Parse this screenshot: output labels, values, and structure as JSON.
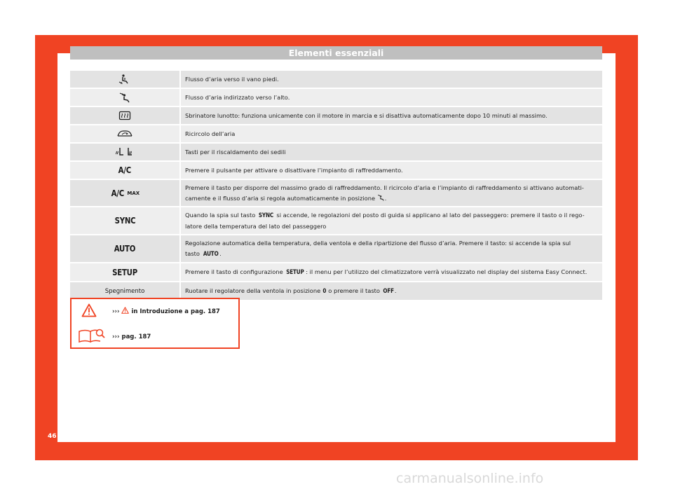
{
  "header": {
    "title": "Elementi essenziali"
  },
  "rows": [
    {
      "icon": "airflow-feet-icon",
      "desc": "Flusso d’aria verso il vano piedi."
    },
    {
      "icon": "airflow-up-icon",
      "desc": "Flusso d’aria indirizzato verso l’alto."
    },
    {
      "icon": "rear-defrost-icon",
      "desc": "Sbrinatore lunotto: funziona unicamente con il motore in marcia e si disattiva automaticamente dopo 10 minuti al massimo."
    },
    {
      "icon": "air-recirculation-icon",
      "desc": "Ricircolo dell’aria"
    },
    {
      "icon": "seat-heating-icon",
      "desc": "Tasti per il riscaldamento dei sedili"
    },
    {
      "label": "A/C",
      "desc": "Premere il pulsante per attivare o disattivare l’impianto di raffreddamento."
    },
    {
      "label": "A/C",
      "label_sub": "MAX",
      "desc_a": "Premere il tasto per disporre del massimo grado di raffreddamento. Il ricircolo d’aria e l’impianto di raffreddamento si attivano automati-",
      "desc_b": "camente e il flusso d’aria si regola automaticamente in posizione",
      "desc_b_end": "."
    },
    {
      "label": "SYNC",
      "desc_a1": "Quando la spia sul tasto",
      "desc_a_badge": "SYNC",
      "desc_a2": "si accende, le regolazioni del posto di guida si applicano al lato del passeggero: premere il tasto o il rego-",
      "desc_b": "latore della temperatura del lato del passeggero"
    },
    {
      "label": "AUTO",
      "desc_a": "Regolazione automatica della temperatura, della ventola e della ripartizione del flusso d’aria. Premere il tasto: si accende la spia sul",
      "desc_b1": "tasto",
      "desc_b_badge": "AUTO",
      "desc_b_end": "."
    },
    {
      "label": "SETUP",
      "desc_1": "Premere il tasto di configurazione",
      "desc_badge": "SETUP",
      "desc_2": ": il menu per l’utilizzo del climatizzatore verrà visualizzato nel display del sistema Easy Connect."
    },
    {
      "label_plain": "Spegnimento",
      "desc_1": "Ruotare il regolatore della ventola in posizione",
      "desc_badge1": "0",
      "desc_2": "o premere il tasto",
      "desc_badge2": "OFF",
      "desc_3": "."
    }
  ],
  "warnings": {
    "warning_line_prefix": "›››",
    "warning_line_text": "in Introduzione a pag. 187",
    "manual_line_prefix": "›››",
    "manual_line_text": "pag. 187"
  },
  "footer": {
    "page_number": "46"
  },
  "watermark": "carmanualsonline.info",
  "colors": {
    "accent": "#f04323",
    "row_bg": "#e3e3e3",
    "header_bg": "#bfbfbf"
  }
}
